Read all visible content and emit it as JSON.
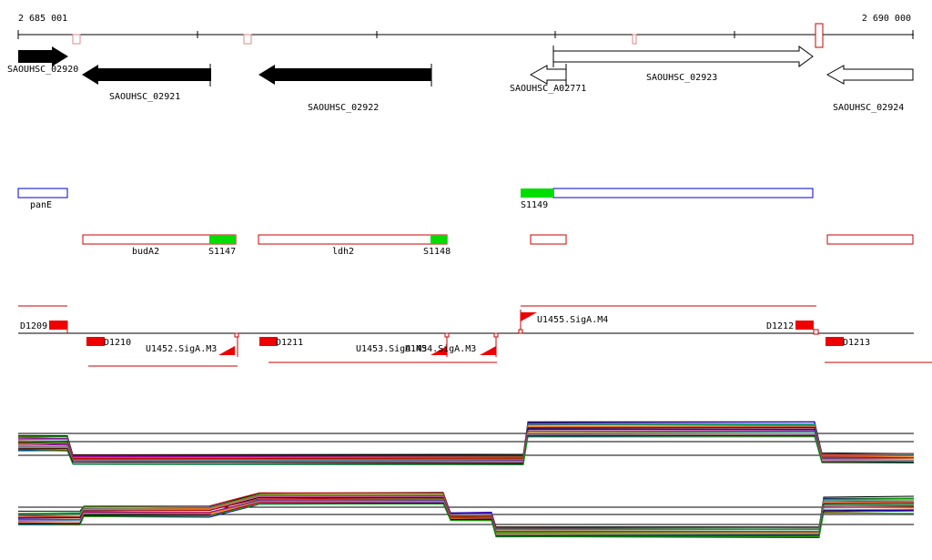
{
  "ruler": {
    "start_label": "2 685 001",
    "end_label": "2 690 000"
  },
  "genes": [
    {
      "label": "SAOUHSC_02920",
      "strand": "plus",
      "fill": "#000000"
    },
    {
      "label": "SAOUHSC_02921",
      "strand": "minus",
      "fill": "#000000"
    },
    {
      "label": "SAOUHSC_02922",
      "strand": "minus",
      "fill": "#000000"
    },
    {
      "label": "SAOUHSC_A02771",
      "strand": "minus",
      "fill": "#ffffff"
    },
    {
      "label": "SAOUHSC_02923",
      "strand": "plus",
      "fill": "#ffffff"
    },
    {
      "label": "SAOUHSC_02924",
      "strand": "minus",
      "fill": "#ffffff"
    }
  ],
  "features": {
    "blue": [
      "panE",
      "S1149"
    ],
    "red": [
      "budA2",
      "S1147",
      "ldh2",
      "S1148"
    ],
    "green_labels": [
      "S1147",
      "S1148",
      "S1149"
    ]
  },
  "regulation": {
    "d_labels": [
      "D1209",
      "D1210",
      "D1211",
      "D1212",
      "D1213"
    ],
    "u_labels": [
      "U1452.SigA.M3",
      "U1453.SigA.M3",
      "U1454.SigA.M3",
      "U1455.SigA.M4"
    ]
  },
  "colors": {
    "axis": "#000000",
    "feature_blue": "#0000cc",
    "feature_red": "#cc0000",
    "highlight_green": "#00dd00",
    "marker_red": "#ee0000",
    "trace_palette": [
      "#000000",
      "#cc0000",
      "#0000cc",
      "#00aa00",
      "#aa6600",
      "#9900aa",
      "#00aaaa",
      "#777777",
      "#ff6600",
      "#cc66aa"
    ]
  }
}
